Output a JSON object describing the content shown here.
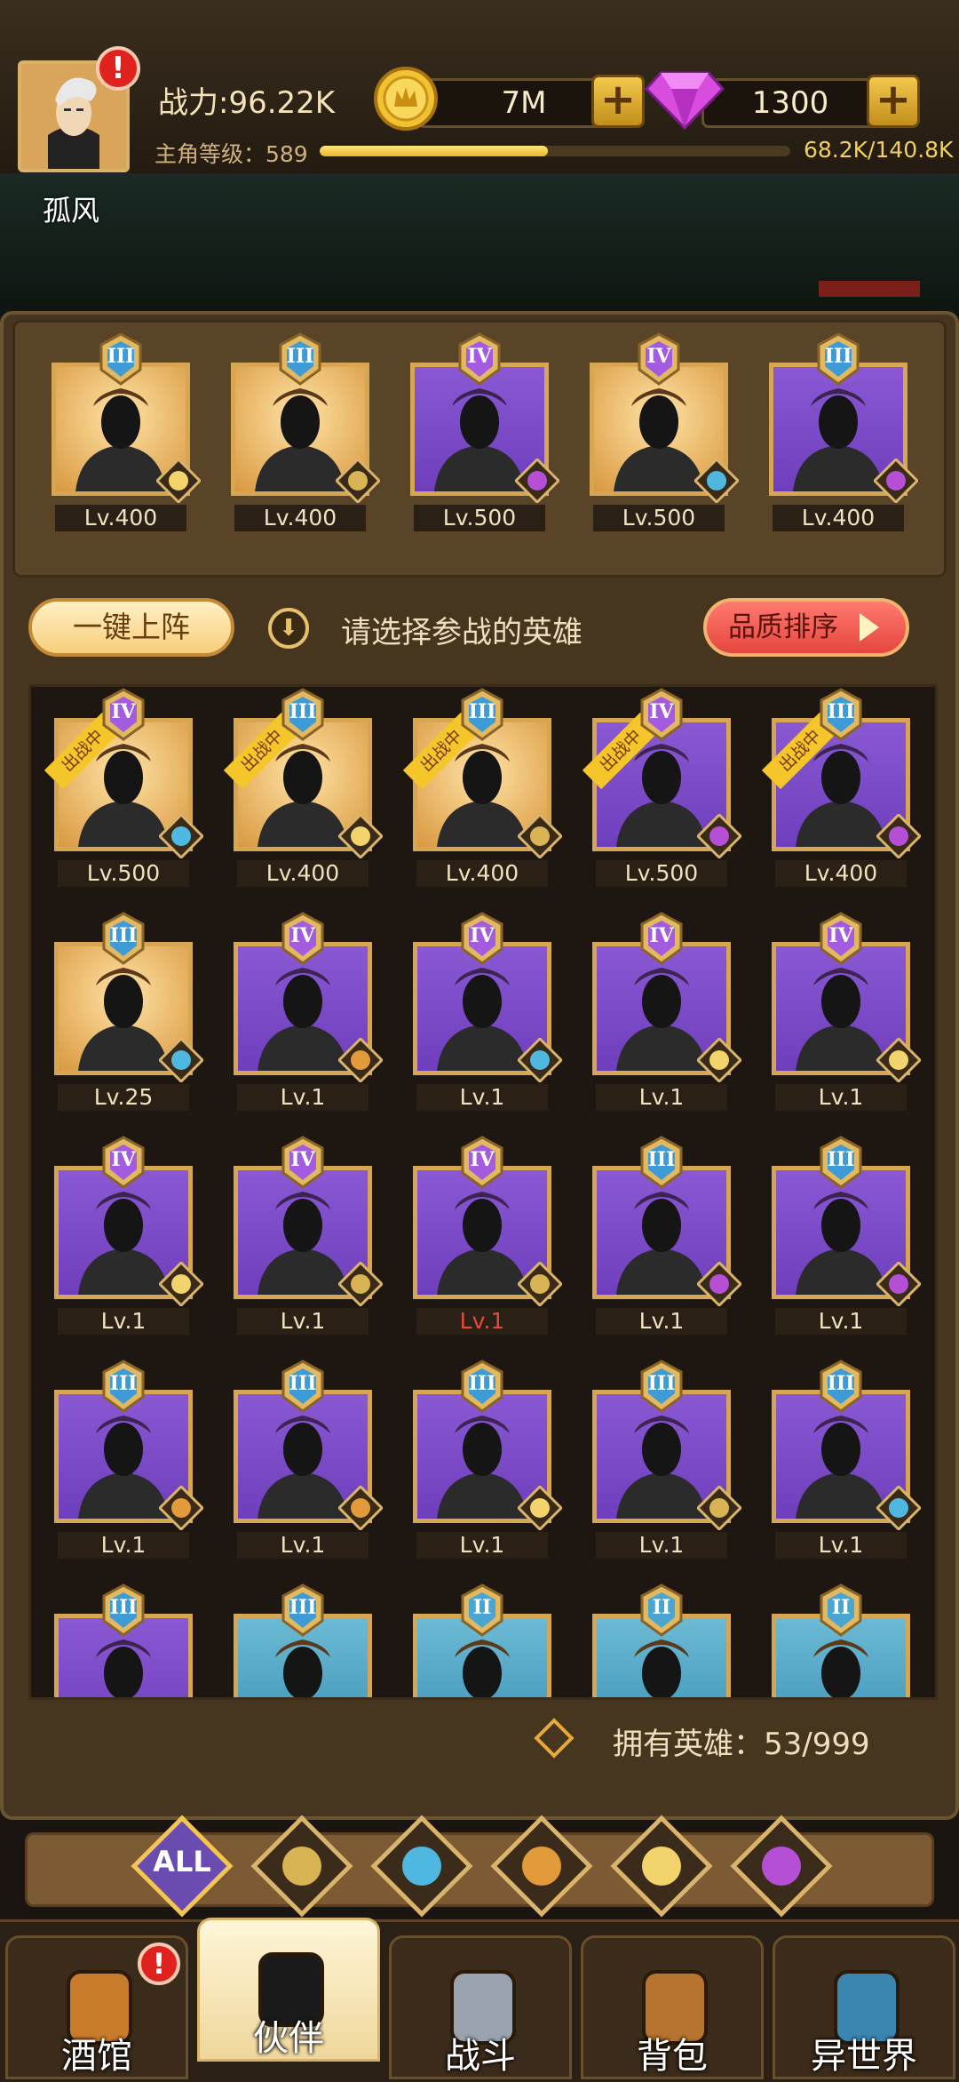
{
  "player": {
    "power": "战力:96.22K",
    "level_label": "主角等级：589",
    "exp_text": "68.2K/140.8K",
    "exp_progress": 0.4844,
    "name": "孤风",
    "has_alert": true,
    "alert_glyph": "!"
  },
  "resources": {
    "gold": "7M",
    "gems": "1300",
    "plus_glyph": "+"
  },
  "lineup": [
    {
      "rank": "III",
      "level": "Lv.400",
      "bg": "gold",
      "faction": "elf"
    },
    {
      "rank": "III",
      "level": "Lv.400",
      "bg": "gold",
      "faction": "human"
    },
    {
      "rank": "IV",
      "level": "Lv.500",
      "bg": "purple",
      "faction": "demon"
    },
    {
      "rank": "IV",
      "level": "Lv.500",
      "bg": "gold",
      "faction": "fishman"
    },
    {
      "rank": "III",
      "level": "Lv.400",
      "bg": "purple",
      "faction": "demon"
    }
  ],
  "controls": {
    "auto_deploy": "一键上阵",
    "hint": "请选择参战的英雄",
    "sort": "品质排序",
    "deployed_tag": "出战中"
  },
  "heroes": [
    {
      "rank": "IV",
      "level": "Lv.500",
      "bg": "gold",
      "faction": "fishman",
      "deployed": true
    },
    {
      "rank": "III",
      "level": "Lv.400",
      "bg": "gold",
      "faction": "elf",
      "deployed": true
    },
    {
      "rank": "III",
      "level": "Lv.400",
      "bg": "gold",
      "faction": "human",
      "deployed": true
    },
    {
      "rank": "IV",
      "level": "Lv.500",
      "bg": "purple",
      "faction": "demon",
      "deployed": true
    },
    {
      "rank": "III",
      "level": "Lv.400",
      "bg": "purple",
      "faction": "demon",
      "deployed": true
    },
    {
      "rank": "III",
      "level": "Lv.25",
      "bg": "gold",
      "faction": "fishman"
    },
    {
      "rank": "IV",
      "level": "Lv.1",
      "bg": "purple",
      "faction": "beast"
    },
    {
      "rank": "IV",
      "level": "Lv.1",
      "bg": "purple",
      "faction": "fishman"
    },
    {
      "rank": "IV",
      "level": "Lv.1",
      "bg": "purple",
      "faction": "elf"
    },
    {
      "rank": "IV",
      "level": "Lv.1",
      "bg": "purple",
      "faction": "elf"
    },
    {
      "rank": "IV",
      "level": "Lv.1",
      "bg": "purple",
      "faction": "elf"
    },
    {
      "rank": "IV",
      "level": "Lv.1",
      "bg": "purple",
      "faction": "human"
    },
    {
      "rank": "IV",
      "level": "Lv.1",
      "bg": "purple",
      "faction": "human",
      "red": true
    },
    {
      "rank": "III",
      "level": "Lv.1",
      "bg": "purple",
      "faction": "demon"
    },
    {
      "rank": "III",
      "level": "Lv.1",
      "bg": "purple",
      "faction": "demon"
    },
    {
      "rank": "III",
      "level": "Lv.1",
      "bg": "purple",
      "faction": "beast"
    },
    {
      "rank": "III",
      "level": "Lv.1",
      "bg": "purple",
      "faction": "beast"
    },
    {
      "rank": "III",
      "level": "Lv.1",
      "bg": "purple",
      "faction": "elf"
    },
    {
      "rank": "III",
      "level": "Lv.1",
      "bg": "purple",
      "faction": "human"
    },
    {
      "rank": "III",
      "level": "Lv.1",
      "bg": "purple",
      "faction": "fishman"
    },
    {
      "rank": "III",
      "level": "",
      "bg": "purple",
      "faction": "none"
    },
    {
      "rank": "III",
      "level": "",
      "bg": "blue",
      "faction": "none"
    },
    {
      "rank": "II",
      "level": "",
      "bg": "blue",
      "faction": "none"
    },
    {
      "rank": "II",
      "level": "",
      "bg": "blue",
      "faction": "none"
    },
    {
      "rank": "II",
      "level": "",
      "bg": "blue",
      "faction": "none"
    }
  ],
  "owned": "拥有英雄：53/999",
  "filters": [
    {
      "id": "all",
      "label": "ALL",
      "icon": "all-icon"
    },
    {
      "id": "human",
      "icon": "human-faction-icon"
    },
    {
      "id": "fishman",
      "icon": "fishman-faction-icon"
    },
    {
      "id": "beast",
      "icon": "beast-faction-icon"
    },
    {
      "id": "elf",
      "icon": "elf-faction-icon"
    },
    {
      "id": "demon",
      "icon": "demon-faction-icon"
    }
  ],
  "nav": [
    {
      "label": "酒馆",
      "icon": "beer-mug-icon",
      "alert": true
    },
    {
      "label": "伙伴",
      "icon": "partner-icon",
      "active": true
    },
    {
      "label": "战斗",
      "icon": "crossed-swords-icon"
    },
    {
      "label": "背包",
      "icon": "backpack-icon"
    },
    {
      "label": "异世界",
      "icon": "portal-icon"
    }
  ],
  "colors": {
    "purple": "#7b4bc9",
    "gold": "#e3a64c",
    "blue": "#55a8c8",
    "frame": "#d6a653"
  }
}
